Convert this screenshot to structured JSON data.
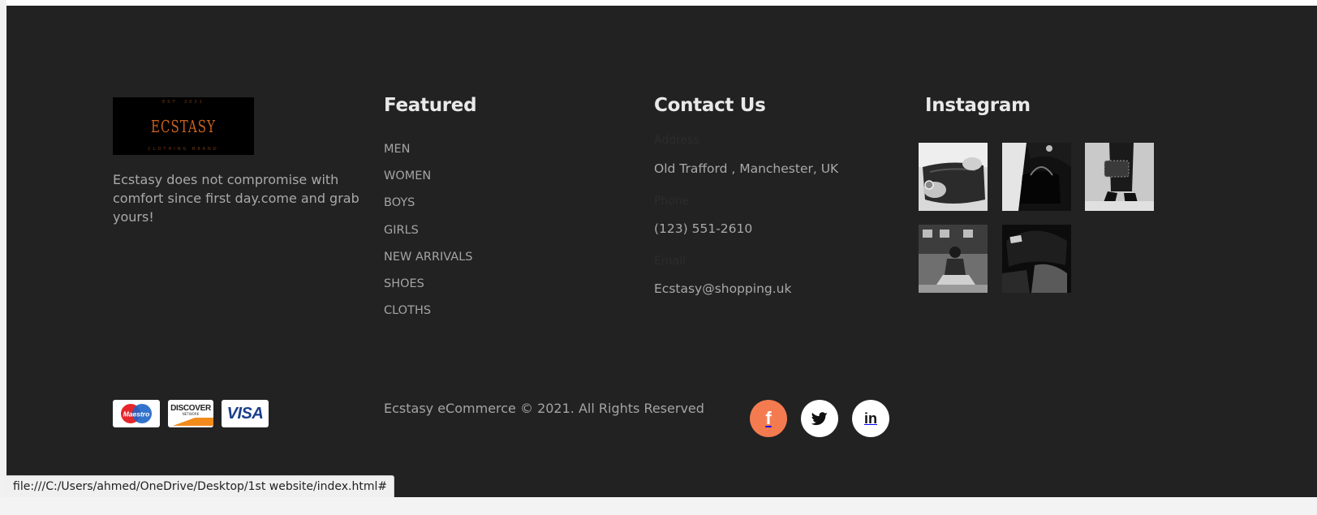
{
  "brand": {
    "logo_text": "ECSTASY",
    "logo_tagline_top": "EST. 2021",
    "logo_tagline_bottom": "CLOTHING BRAND",
    "about": "Ecstasy does not compromise with comfort since first day.come and grab yours!"
  },
  "featured": {
    "title": "Featured",
    "items": [
      "MEN",
      "WOMEN",
      "BOYS",
      "GIRLS",
      "NEW ARRIVALS",
      "SHOES",
      "CLOTHS"
    ]
  },
  "contact": {
    "title": "Contact Us",
    "address_label": "Address",
    "address": "Old Trafford , Manchester, UK",
    "phone_label": "Phone",
    "phone": "(123) 551-2610",
    "email_label": "Email",
    "email": "Ecstasy@shopping.uk"
  },
  "instagram": {
    "title": "Instagram",
    "photos": [
      "instagram-photo-watch-bag",
      "instagram-photo-handbag",
      "instagram-photo-clutch-heels",
      "instagram-photo-street-sitting",
      "instagram-photo-cap"
    ]
  },
  "payments": {
    "maestro": "Maestro",
    "discover": "DISCOVER",
    "discover_sub": "NETWORK",
    "visa": "VISA"
  },
  "copyright": "Ecstasy eCommerce © 2021. All Rights Reserved",
  "social": {
    "facebook": "f",
    "twitter_icon": "twitter-bird-icon",
    "linkedin": "in"
  },
  "status_bar": "file:///C:/Users/ahmed/OneDrive/Desktop/1st website/index.html#",
  "colors": {
    "background": "#222222",
    "accent": "#f47b50",
    "text": "#a9a9a9",
    "heading": "#e9e9e9"
  }
}
